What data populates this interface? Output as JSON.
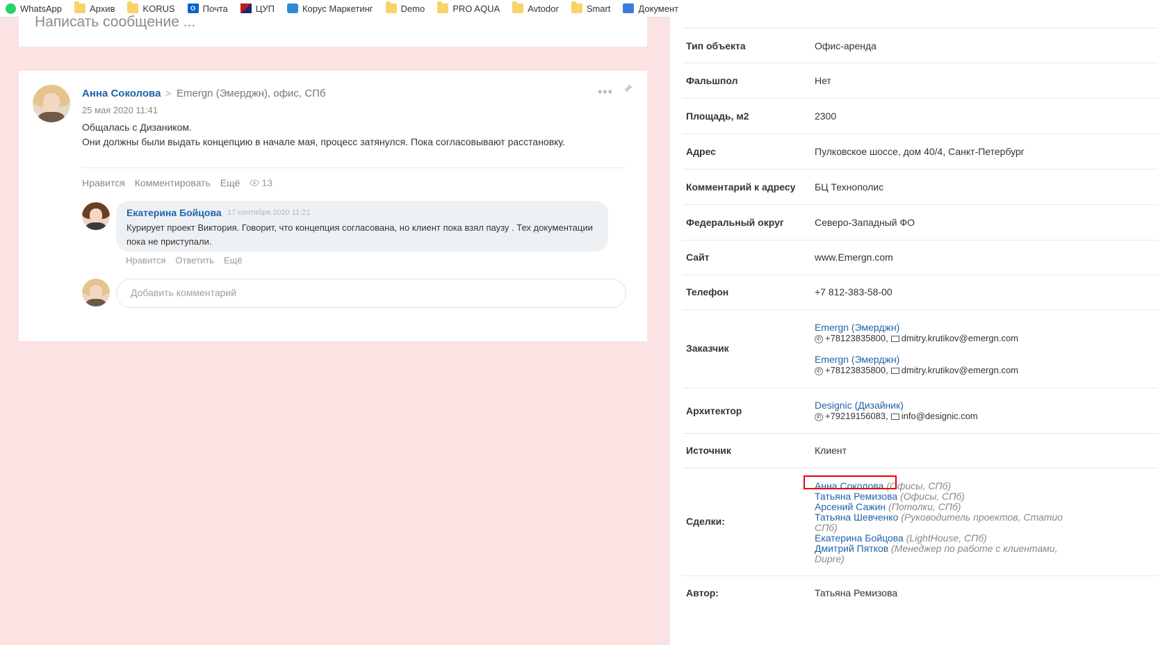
{
  "bookmarks": [
    {
      "label": "WhatsApp",
      "icon": "whatsapp-icon"
    },
    {
      "label": "Архив",
      "icon": "folder-icon"
    },
    {
      "label": "KORUS",
      "icon": "folder-icon"
    },
    {
      "label": "Почта",
      "icon": "outlook-icon"
    },
    {
      "label": "ЦУП",
      "icon": "tsup-icon"
    },
    {
      "label": "Корус Маркетинг",
      "icon": "korus-icon"
    },
    {
      "label": "Demo",
      "icon": "folder-icon"
    },
    {
      "label": "PRO AQUA",
      "icon": "folder-icon"
    },
    {
      "label": "Avtodor",
      "icon": "folder-icon"
    },
    {
      "label": "Smart",
      "icon": "folder-icon"
    },
    {
      "label": "Документ",
      "icon": "document-icon"
    }
  ],
  "compose": {
    "placeholder": "Написать сообщение ..."
  },
  "post": {
    "author": "Анна Соколова",
    "destination": "Emergn (Эмерджн), офис, СПб",
    "date": "25 мая 2020 11:41",
    "lines": [
      "Общалась с Дизаником.",
      "Они должны были выдать концепцию в начале мая, процесс затянулся. Пока согласовывают расстановку."
    ],
    "actions": {
      "like": "Нравится",
      "comment": "Комментировать",
      "more": "Ещё",
      "views": "13"
    }
  },
  "comment": {
    "author": "Екатерина Бойцова",
    "date": "17 сентября 2020 11:21",
    "text": "Курирует проект Виктория. Говорит, что концепция согласована, но клиент пока взял паузу . Тех документации пока не приступали.",
    "actions": {
      "like": "Нравится",
      "reply": "Ответить",
      "more": "Ещё"
    }
  },
  "add_comment": {
    "placeholder": "Добавить комментарий"
  },
  "details": {
    "object_type": {
      "label": "Тип объекта",
      "value": "Офис-аренда"
    },
    "false_floor": {
      "label": "Фальшпол",
      "value": "Нет"
    },
    "area": {
      "label": "Площадь, м2",
      "value": "2300"
    },
    "address": {
      "label": "Адрес",
      "value": "Пулковское шоссе, дом 40/4, Санкт-Петербург"
    },
    "address_comment": {
      "label": "Комментарий к адресу",
      "value": "БЦ Технополис"
    },
    "federal_district": {
      "label": "Федеральный округ",
      "value": "Северо-Западный ФО"
    },
    "site": {
      "label": "Сайт",
      "value": "www.Emergn.com"
    },
    "phone": {
      "label": "Телефон",
      "value": "+7 812-383-58-00"
    },
    "customer": {
      "label": "Заказчик",
      "entries": [
        {
          "name": "Emergn (Эмерджн)",
          "phone": "+78123835800,",
          "email": "dmitry.krutikov@emergn.com"
        },
        {
          "name": "Emergn (Эмерджн)",
          "phone": "+78123835800,",
          "email": "dmitry.krutikov@emergn.com"
        }
      ]
    },
    "architect": {
      "label": "Архитектор",
      "name": "Designic (Дизайник)",
      "phone": "+79219156083,",
      "email": "info@designic.com"
    },
    "source": {
      "label": "Источник",
      "value": "Клиент"
    },
    "deals": {
      "label": "Сделки:",
      "items": [
        {
          "name": "Анна Соколова",
          "note": "(Офисы, СПб)"
        },
        {
          "name": "Татьяна Ремизова",
          "note": "(Офисы, СПб)"
        },
        {
          "name": "Арсений Сажин",
          "note": "(Потолки, СПб)"
        },
        {
          "name": "Татьяна Шевченко",
          "note": "(Руководитель проектов, Статио СПб)"
        },
        {
          "name": "Екатерина Бойцова",
          "note": "(LightHouse, СПб)"
        },
        {
          "name": "Дмитрий Пятков",
          "note": "(Менеджер по работе с клиентами, Dupre)"
        }
      ]
    },
    "author": {
      "label": "Автор:",
      "value": "Татьяна Ремизова"
    }
  }
}
